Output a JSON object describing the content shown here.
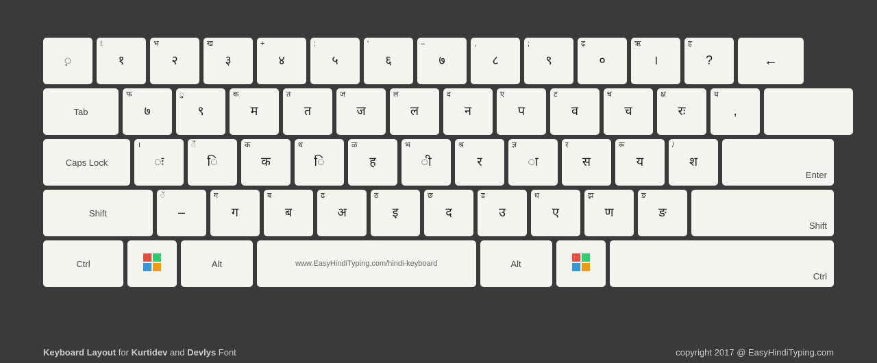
{
  "keyboard": {
    "rows": [
      {
        "keys": [
          {
            "id": "grave",
            "top": "",
            "main": "़",
            "w": "standard"
          },
          {
            "id": "1",
            "top": "!",
            "main": "१",
            "w": "standard"
          },
          {
            "id": "2",
            "top": "भ",
            "main": "२",
            "w": "standard"
          },
          {
            "id": "3",
            "top": "ख",
            "main": "३",
            "w": "standard"
          },
          {
            "id": "4",
            "top": "+",
            "main": "४",
            "w": "standard"
          },
          {
            "id": "5",
            "top": ":",
            "main": "५",
            "w": "standard"
          },
          {
            "id": "6",
            "top": "'",
            "main": "६",
            "w": "standard"
          },
          {
            "id": "7",
            "top": "–",
            "main": "७",
            "w": "standard"
          },
          {
            "id": "8",
            "top": ",",
            "main": "८",
            "w": "standard"
          },
          {
            "id": "9",
            "top": ";",
            "main": "९",
            "w": "standard"
          },
          {
            "id": "0",
            "top": "ढ़",
            "main": "०",
            "w": "standard"
          },
          {
            "id": "minus",
            "top": "ऋ",
            "main": "।",
            "w": "standard"
          },
          {
            "id": "equals",
            "top": "ह",
            "main": "?",
            "w": "standard"
          },
          {
            "id": "backspace",
            "top": "",
            "main": "←",
            "w": "backspace"
          }
        ]
      },
      {
        "keys": [
          {
            "id": "tab",
            "top": "",
            "main": "Tab",
            "w": "tab",
            "isLabel": true
          },
          {
            "id": "q",
            "top": "फ",
            "main": "७",
            "w": "standard"
          },
          {
            "id": "w",
            "top": "ु",
            "main": "९",
            "w": "standard"
          },
          {
            "id": "e",
            "top": "क",
            "main": "म",
            "w": "standard"
          },
          {
            "id": "r",
            "top": "त",
            "main": "त",
            "w": "standard"
          },
          {
            "id": "t",
            "top": "ज",
            "main": "ज",
            "w": "standard"
          },
          {
            "id": "y",
            "top": "ल",
            "main": "ल",
            "w": "standard"
          },
          {
            "id": "u",
            "top": "द",
            "main": "न",
            "w": "standard"
          },
          {
            "id": "i",
            "top": "ए",
            "main": "प",
            "w": "standard"
          },
          {
            "id": "o",
            "top": "ट",
            "main": "व",
            "w": "standard"
          },
          {
            "id": "p",
            "top": "च",
            "main": "च",
            "w": "standard"
          },
          {
            "id": "lbracket",
            "top": "क्ष",
            "main": "रः",
            "w": "standard"
          },
          {
            "id": "rbracket",
            "top": "ध",
            "main": ",",
            "w": "standard"
          },
          {
            "id": "enter",
            "top": "",
            "main": "",
            "w": "enter",
            "isLabel": true,
            "label": ""
          }
        ]
      },
      {
        "keys": [
          {
            "id": "caps",
            "top": "",
            "main": "Caps Lock",
            "w": "caps",
            "isLabel": true
          },
          {
            "id": "a",
            "top": "।",
            "main": "ः",
            "w": "standard"
          },
          {
            "id": "s",
            "top": "ँ",
            "main": "ि",
            "w": "standard"
          },
          {
            "id": "d",
            "top": "क",
            "main": "क",
            "w": "standard"
          },
          {
            "id": "f",
            "top": "थ",
            "main": "ि",
            "w": "standard"
          },
          {
            "id": "g",
            "top": "ळ",
            "main": "ह",
            "w": "standard"
          },
          {
            "id": "h",
            "top": "भ",
            "main": "ी",
            "w": "standard"
          },
          {
            "id": "j",
            "top": "श्र",
            "main": "र",
            "w": "standard"
          },
          {
            "id": "k",
            "top": "ज्ञ",
            "main": "ा",
            "w": "standard"
          },
          {
            "id": "l",
            "top": "र",
            "main": "स",
            "w": "standard"
          },
          {
            "id": "semi",
            "top": "रू",
            "main": "य",
            "w": "standard"
          },
          {
            "id": "quote",
            "top": "/",
            "main": "श",
            "w": "standard"
          },
          {
            "id": "enter2",
            "top": "",
            "main": "Enter",
            "w": "enter",
            "isEnter": true
          }
        ]
      },
      {
        "keys": [
          {
            "id": "shift-l",
            "top": "",
            "main": "Shift",
            "w": "shift-left",
            "isLabel": true
          },
          {
            "id": "z",
            "top": "ॅ",
            "main": "–",
            "w": "standard"
          },
          {
            "id": "x",
            "top": "ग",
            "main": "ग",
            "w": "standard"
          },
          {
            "id": "c",
            "top": "ब",
            "main": "ब",
            "w": "standard"
          },
          {
            "id": "v",
            "top": "ढ",
            "main": "अ",
            "w": "standard"
          },
          {
            "id": "b",
            "top": "ठ",
            "main": "इ",
            "w": "standard"
          },
          {
            "id": "n",
            "top": "छ",
            "main": "द",
            "w": "standard"
          },
          {
            "id": "m",
            "top": "ड",
            "main": "उ",
            "w": "standard"
          },
          {
            "id": "comma",
            "top": "ध",
            "main": "ए",
            "w": "standard"
          },
          {
            "id": "period",
            "top": "झ",
            "main": "ण",
            "w": "standard"
          },
          {
            "id": "slash",
            "top": "ङ",
            "main": "ङ",
            "w": "standard"
          },
          {
            "id": "shift-r",
            "top": "",
            "main": "Shift",
            "w": "shift-right",
            "isLabel": true
          }
        ]
      },
      {
        "keys": [
          {
            "id": "ctrl-l",
            "top": "",
            "main": "Ctrl",
            "w": "ctrl",
            "isLabel": true
          },
          {
            "id": "win-l",
            "top": "",
            "main": "win",
            "w": "win",
            "isWin": true
          },
          {
            "id": "alt-l",
            "top": "",
            "main": "Alt",
            "w": "alt-left",
            "isLabel": true
          },
          {
            "id": "space",
            "top": "",
            "main": "www.EasyHindiTyping.com/hindi-keyboard",
            "w": "space",
            "isLabel": true
          },
          {
            "id": "alt-r",
            "top": "",
            "main": "Alt",
            "w": "alt-left",
            "isLabel": true
          },
          {
            "id": "win-r",
            "top": "",
            "main": "win",
            "w": "win",
            "isWin": true
          },
          {
            "id": "ctrl-r",
            "top": "",
            "main": "Ctrl",
            "w": "ctrl-right",
            "isLabel": true
          }
        ]
      }
    ]
  },
  "footer": {
    "left": "Keyboard Layout for Kurtidev and Devlys Font",
    "left_bold_1": "Keyboard Layout",
    "left_bold_2": "Kurtidev",
    "left_bold_3": "Devlys",
    "right": "copyright 2017 @ EasyHindiTyping.com"
  }
}
